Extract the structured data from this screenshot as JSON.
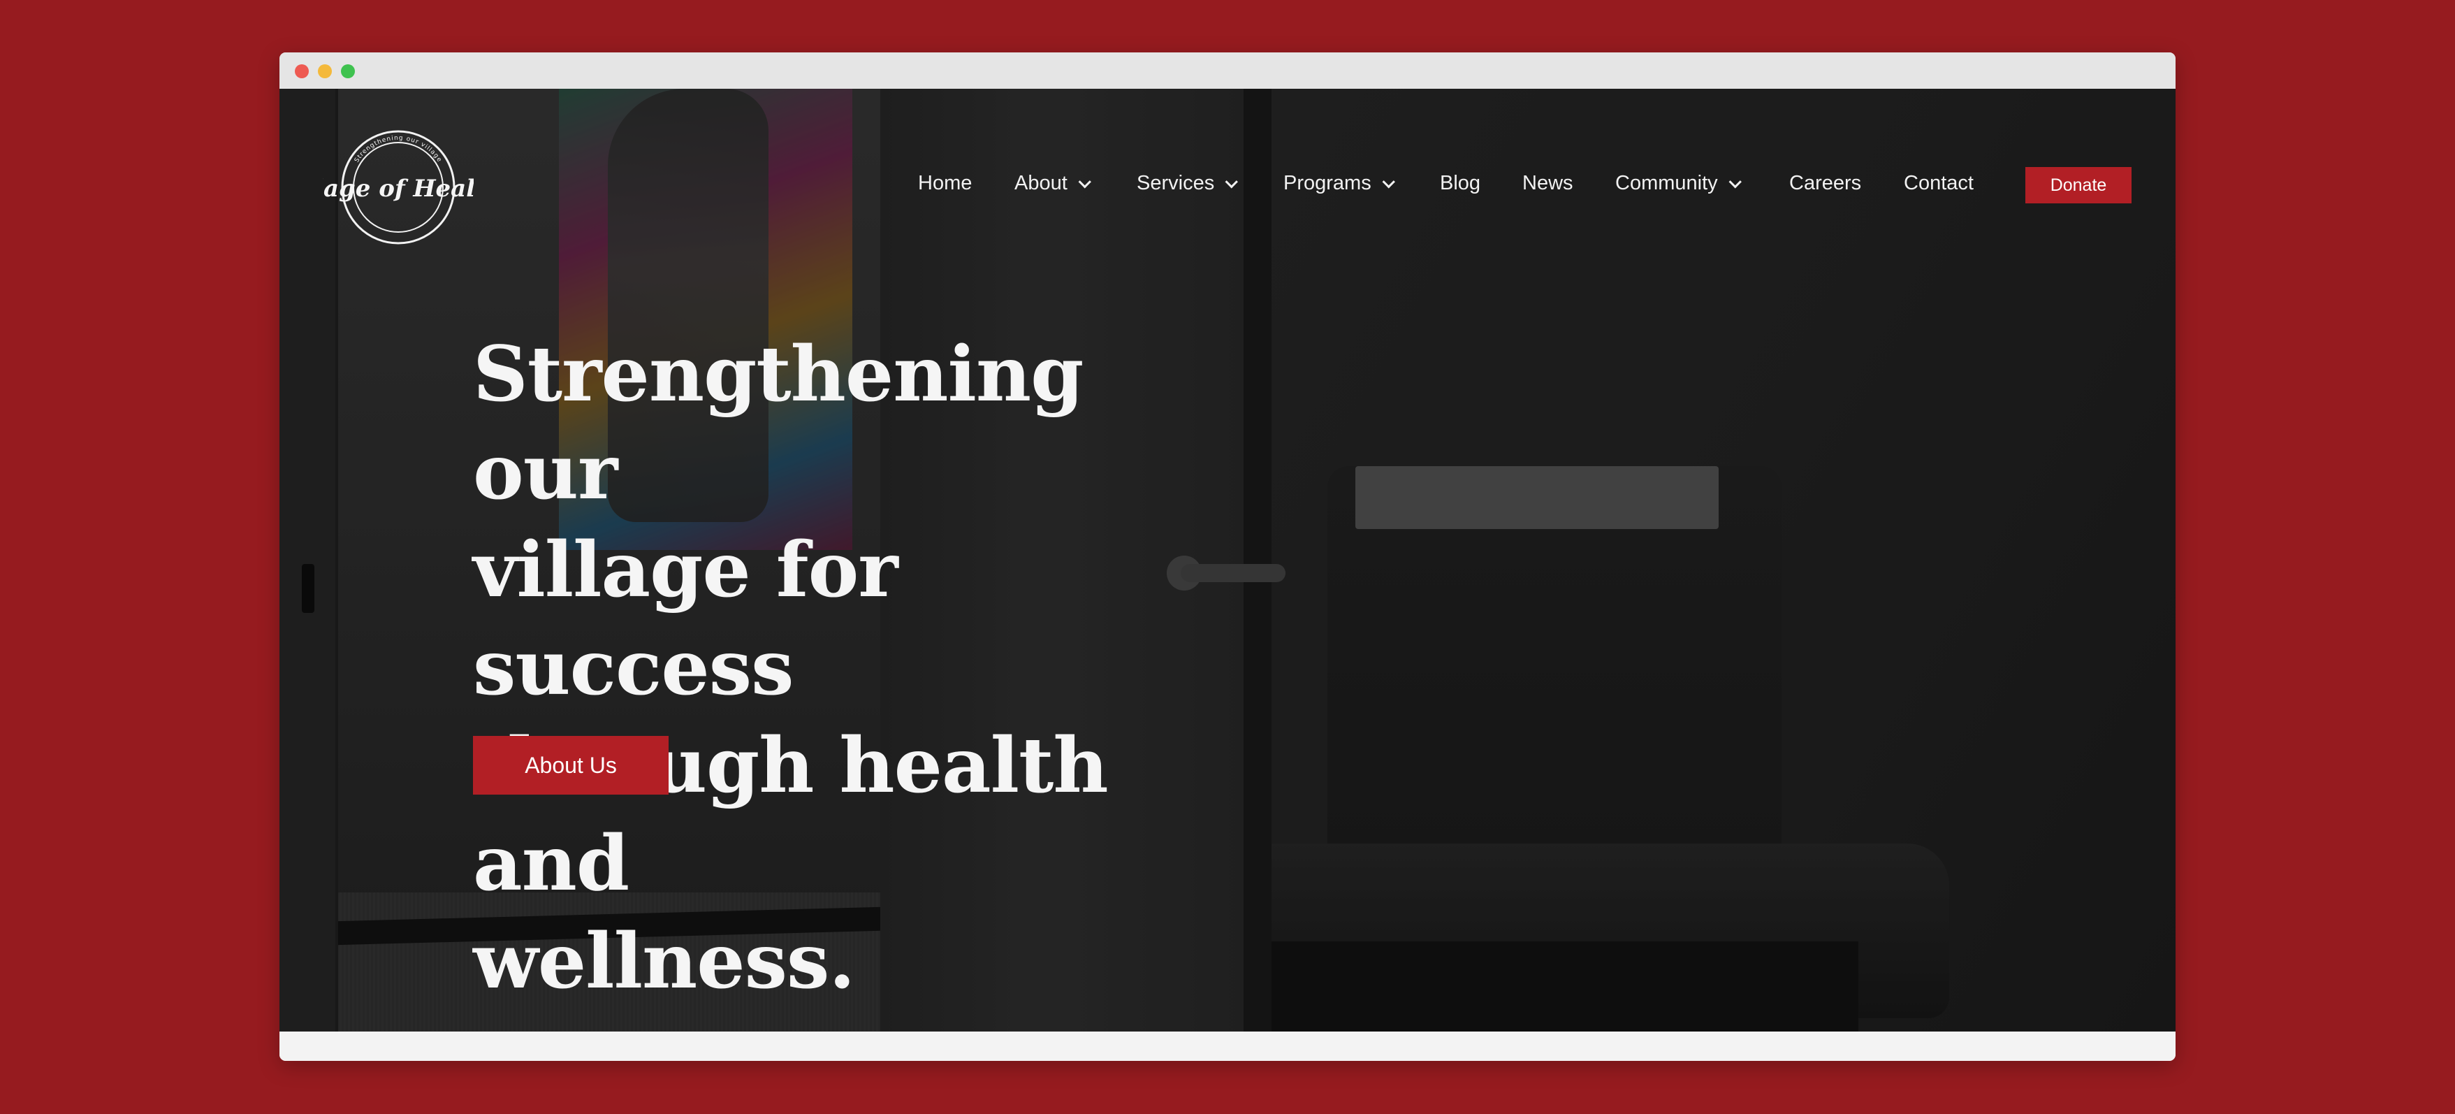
{
  "brand": {
    "logo_text": "Village of Healing",
    "logo_ring_text": "Strengthening our village"
  },
  "nav": {
    "items": [
      {
        "label": "Home",
        "has_dropdown": false
      },
      {
        "label": "About",
        "has_dropdown": true
      },
      {
        "label": "Services",
        "has_dropdown": true
      },
      {
        "label": "Programs",
        "has_dropdown": true
      },
      {
        "label": "Blog",
        "has_dropdown": false
      },
      {
        "label": "News",
        "has_dropdown": false
      },
      {
        "label": "Community",
        "has_dropdown": true
      },
      {
        "label": "Careers",
        "has_dropdown": false
      },
      {
        "label": "Contact",
        "has_dropdown": false
      }
    ],
    "donate_label": "Donate"
  },
  "hero": {
    "title_lines": [
      "Strengthening our",
      "village for success",
      "through health and",
      "wellness."
    ],
    "cta_label": "About Us"
  },
  "colors": {
    "page_background": "#961b1f",
    "accent": "#b21f25",
    "text_light": "#f5f5f5"
  }
}
